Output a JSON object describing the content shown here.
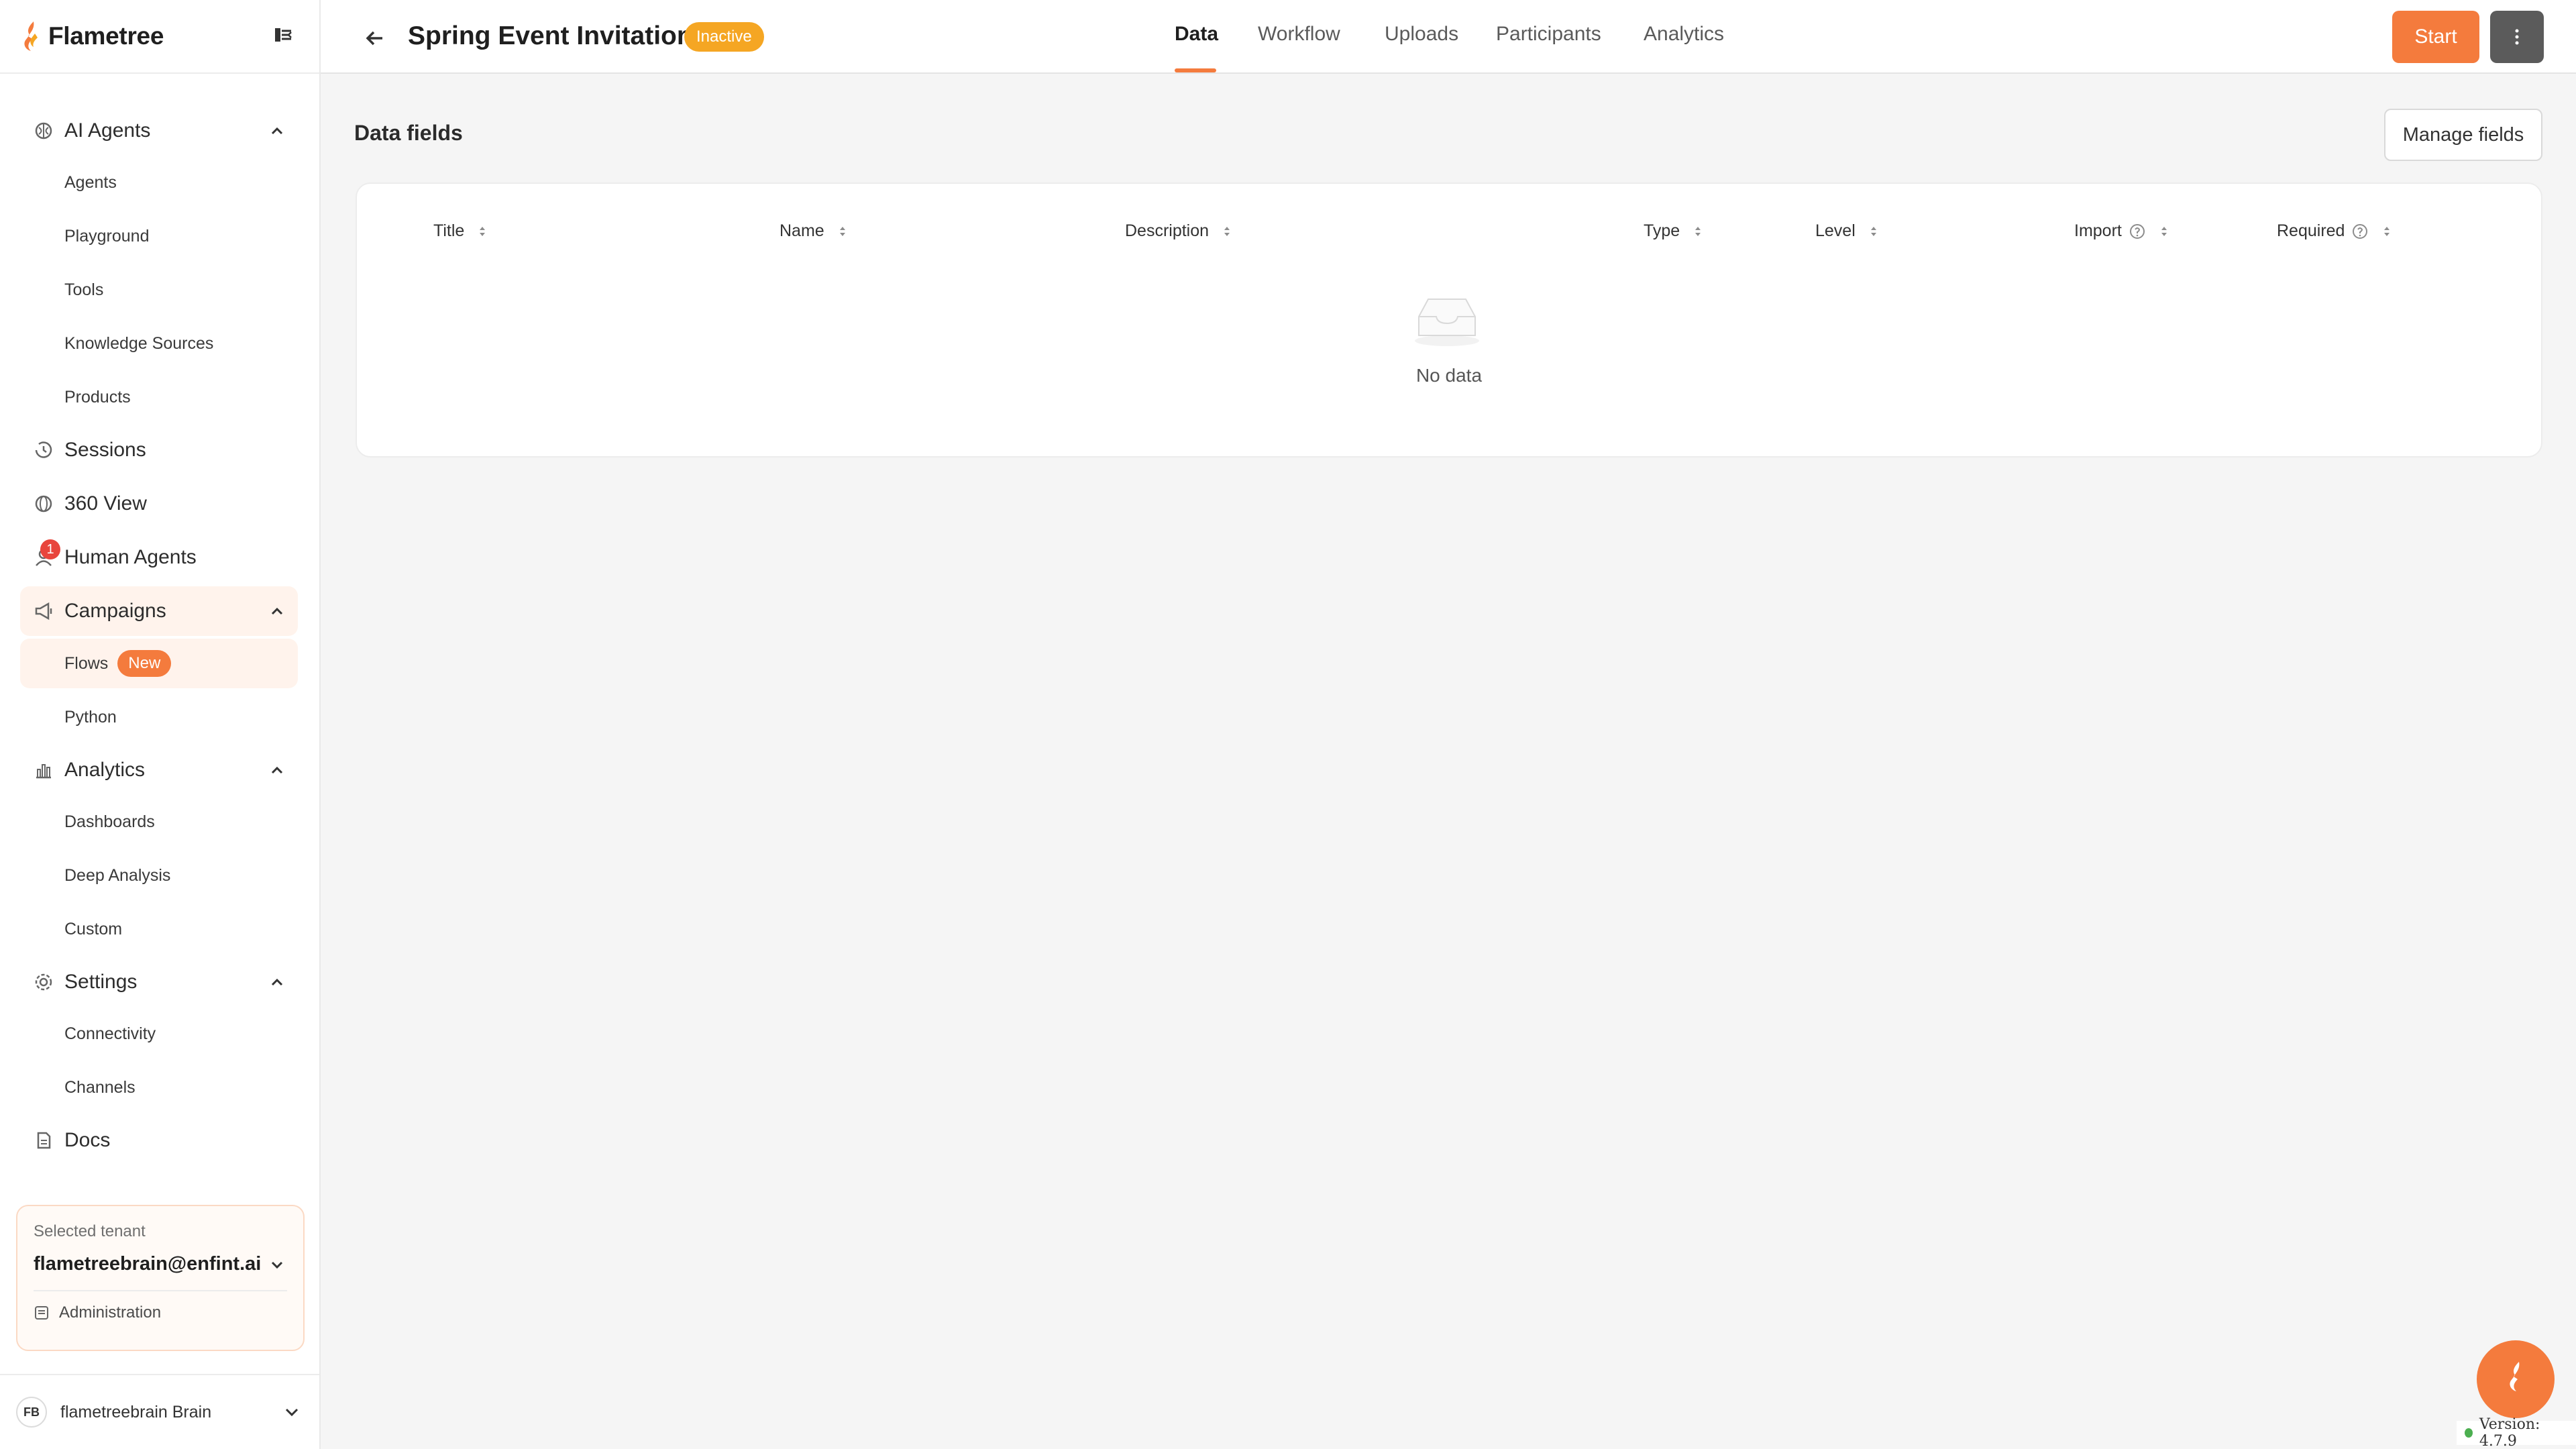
{
  "brand": {
    "name": "Flametree"
  },
  "sidebar": {
    "ai_agents": {
      "label": "AI Agents",
      "items": [
        "Agents",
        "Playground",
        "Tools",
        "Knowledge Sources",
        "Products"
      ]
    },
    "sessions": "Sessions",
    "view360": "360 View",
    "human_agents": {
      "label": "Human Agents",
      "badge": "1"
    },
    "campaigns": {
      "label": "Campaigns",
      "flows": "Flows",
      "flows_badge": "New",
      "python": "Python"
    },
    "analytics": {
      "label": "Analytics",
      "items": [
        "Dashboards",
        "Deep Analysis",
        "Custom"
      ]
    },
    "settings": {
      "label": "Settings",
      "items": [
        "Connectivity",
        "Channels"
      ]
    },
    "docs": "Docs"
  },
  "tenant": {
    "caption": "Selected tenant",
    "email": "flametreebrain@enfint.ai",
    "admin_label": "Administration"
  },
  "account": {
    "initials": "FB",
    "name": "flametreebrain Brain"
  },
  "header": {
    "title": "Spring Event Invitations",
    "status": "Inactive",
    "tabs": [
      "Data",
      "Workflow",
      "Uploads",
      "Participants",
      "Analytics"
    ],
    "active_tab": "Data",
    "start_label": "Start"
  },
  "main": {
    "section_title": "Data fields",
    "manage_label": "Manage fields",
    "columns": [
      "Title",
      "Name",
      "Description",
      "Type",
      "Level",
      "Import",
      "Required"
    ],
    "empty_text": "No data"
  },
  "version": "Version: 4.7.9",
  "colors": {
    "accent": "#f47b3d",
    "status_inactive": "#f5a623",
    "active_bg": "#fff3ec"
  }
}
